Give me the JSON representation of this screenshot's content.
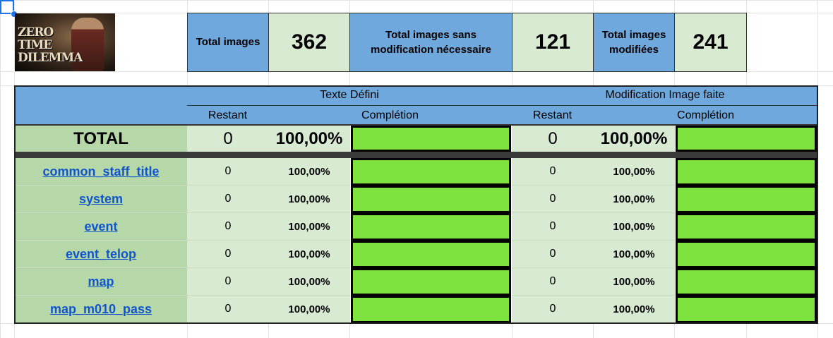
{
  "summary": {
    "total_images_label": "Total images",
    "total_images_value": "362",
    "no_mod_label": "Total images sans modification nécessaire",
    "no_mod_value": "121",
    "modified_label": "Total images modifiées",
    "modified_value": "241"
  },
  "logo": {
    "text_line1": "ZERO TIME",
    "text_line2": "DILEMMA"
  },
  "table": {
    "group1_label": "Texte Défini",
    "group2_label": "Modification Image faite",
    "remaining_label": "Restant",
    "completion_label": "Complétion",
    "total_row": {
      "label": "TOTAL",
      "text_remaining": "0",
      "text_pct": "100,00%",
      "text_fill": 1.0,
      "img_remaining": "0",
      "img_pct": "100,00%",
      "img_fill": 1.0
    },
    "rows": [
      {
        "name": "common_staff_title",
        "text_remaining": "0",
        "text_pct": "100,00%",
        "img_remaining": "0",
        "img_pct": "100,00%"
      },
      {
        "name": "system",
        "text_remaining": "0",
        "text_pct": "100,00%",
        "img_remaining": "0",
        "img_pct": "100,00%"
      },
      {
        "name": "event",
        "text_remaining": "0",
        "text_pct": "100,00%",
        "img_remaining": "0",
        "img_pct": "100,00%"
      },
      {
        "name": "event_telop",
        "text_remaining": "0",
        "text_pct": "100,00%",
        "img_remaining": "0",
        "img_pct": "100,00%"
      },
      {
        "name": "map",
        "text_remaining": "0",
        "text_pct": "100,00%",
        "img_remaining": "0",
        "img_pct": "100,00%"
      },
      {
        "name": "map_m010_pass",
        "text_remaining": "0",
        "text_pct": "100,00%",
        "img_remaining": "0",
        "img_pct": "100,00%"
      }
    ]
  },
  "colors": {
    "header_blue": "#6fa8dc",
    "light_green": "#d9ead3",
    "mid_green": "#b6d7a8",
    "bar_green": "#7ee23f"
  }
}
